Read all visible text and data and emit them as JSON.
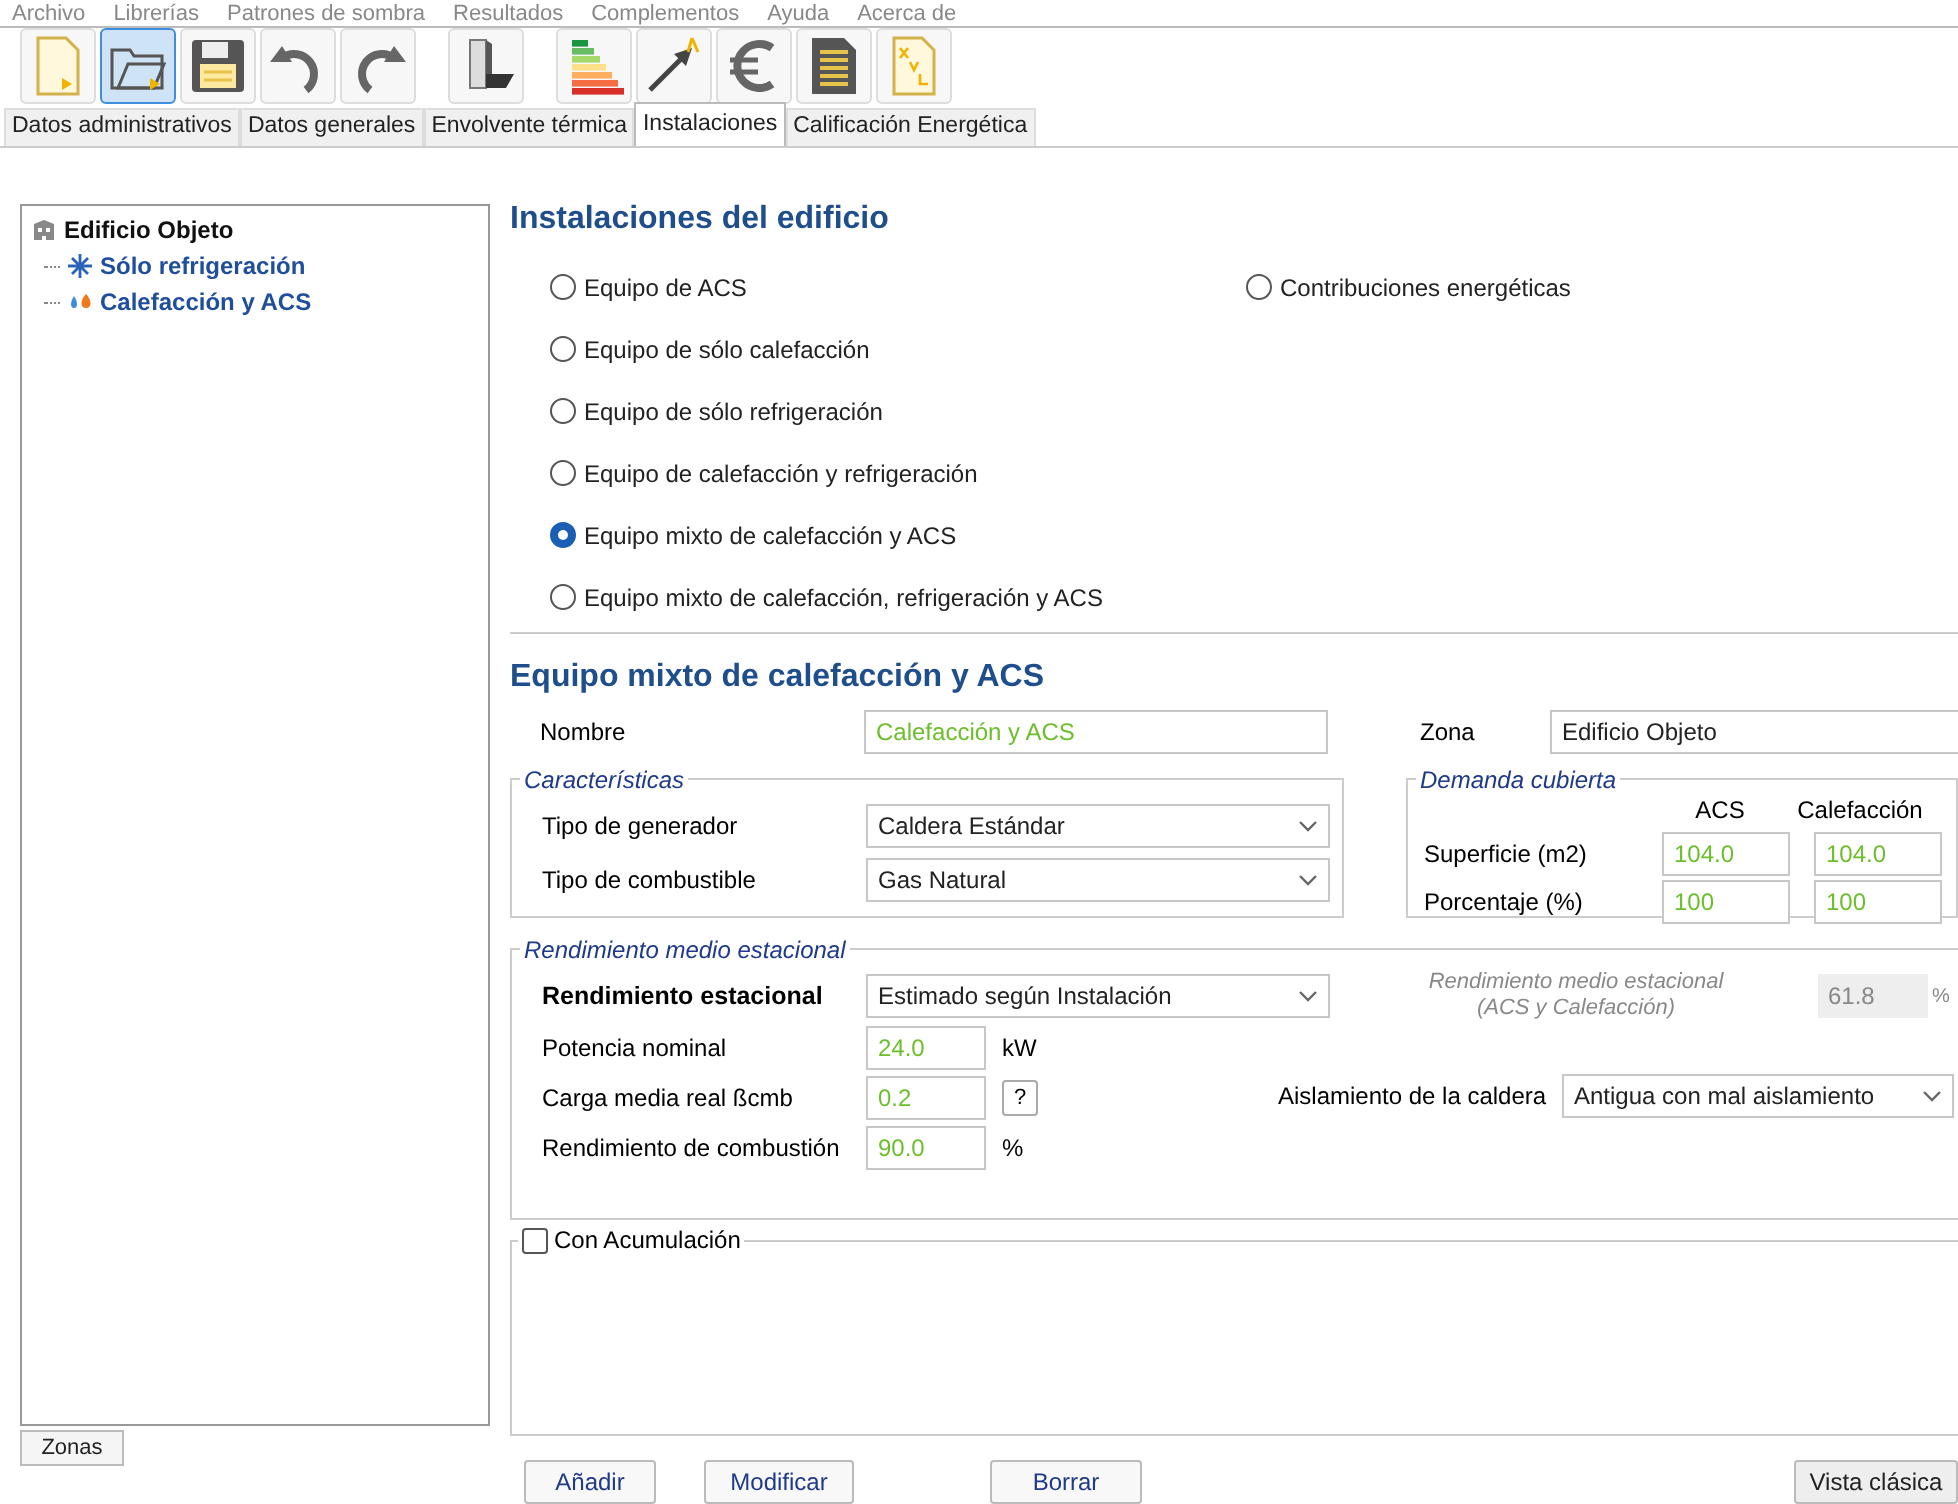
{
  "menu": [
    "Archivo",
    "Librerías",
    "Patrones de sombra",
    "Resultados",
    "Complementos",
    "Ayuda",
    "Acerca de"
  ],
  "toolbar": [
    {
      "kind": "new",
      "selected": false
    },
    {
      "kind": "open",
      "selected": true
    },
    {
      "kind": "save",
      "selected": false
    },
    {
      "kind": "undo",
      "selected": false
    },
    {
      "kind": "redo",
      "selected": false
    },
    {
      "kind": "building",
      "selected": false
    },
    {
      "kind": "rating",
      "selected": false
    },
    {
      "kind": "arrow",
      "selected": false
    },
    {
      "kind": "euro",
      "selected": false
    },
    {
      "kind": "report",
      "selected": false
    },
    {
      "kind": "xml",
      "selected": false
    }
  ],
  "tabs": [
    {
      "label": "Datos administrativos",
      "selected": false
    },
    {
      "label": "Datos generales",
      "selected": false
    },
    {
      "label": "Envolvente térmica",
      "selected": false
    },
    {
      "label": "Instalaciones",
      "selected": true
    },
    {
      "label": "Calificación Energética",
      "selected": false
    }
  ],
  "tree": {
    "label": "Edificio Objeto",
    "children": [
      {
        "label": "Sólo refrigeración",
        "kind": "cooling"
      },
      {
        "label": "Calefacción y ACS",
        "kind": "heating"
      }
    ]
  },
  "zones_button": "Zonas",
  "section_title": "Instalaciones del edificio",
  "options_left": [
    {
      "label": "Equipo de ACS",
      "selected": false
    },
    {
      "label": "Equipo de sólo calefacción",
      "selected": false
    },
    {
      "label": "Equipo de sólo refrigeración",
      "selected": false
    },
    {
      "label": "Equipo de calefacción y refrigeración",
      "selected": false
    },
    {
      "label": "Equipo mixto de calefacción y ACS",
      "selected": true
    },
    {
      "label": "Equipo mixto de calefacción, refrigeración y ACS",
      "selected": false
    }
  ],
  "options_right": [
    {
      "label": "Contribuciones energéticas",
      "selected": false
    }
  ],
  "form_title": "Equipo mixto de calefacción y ACS",
  "name": {
    "label": "Nombre",
    "value": "Calefacción y ACS"
  },
  "zone": {
    "label": "Zona",
    "value": "Edificio Objeto"
  },
  "characteristics": {
    "title": "Características",
    "rows": [
      {
        "label": "Tipo de generador",
        "value": "Caldera Estándar"
      },
      {
        "label": "Tipo de combustible",
        "value": "Gas Natural"
      }
    ]
  },
  "demand": {
    "title": "Demanda cubierta",
    "columns": [
      "ACS",
      "Calefacción"
    ],
    "rows": [
      {
        "label": "Superficie (m2)",
        "values": [
          "104.0",
          "104.0"
        ]
      },
      {
        "label": "Porcentaje (%)",
        "values": [
          "100",
          "100"
        ]
      }
    ]
  },
  "performance": {
    "title": "Rendimiento medio estacional",
    "main_label": "Rendimiento estacional",
    "main_value": "Estimado según Instalación",
    "readout_label": "Rendimiento medio estacional",
    "readout_sublabel": "(ACS y Calefacción)",
    "readout_value": "61.8",
    "readout_unit": "%",
    "fields": [
      {
        "label": "Potencia nominal",
        "value": "24.0",
        "unit": "kW",
        "kind": "unit"
      },
      {
        "label": "Carga media real ßcmb",
        "value": "0.2",
        "unit": "?",
        "kind": "help"
      },
      {
        "label": "Rendimiento de combustión",
        "value": "90.0",
        "unit": "%",
        "kind": "unit"
      }
    ],
    "insulation": {
      "label": "Aislamiento de la caldera",
      "value": "Antigua con mal aislamiento"
    }
  },
  "accumulation": {
    "label": "Con Acumulación",
    "checked": false
  },
  "buttons": [
    "Añadir",
    "Modificar",
    "Borrar"
  ],
  "classic_button": "Vista clásica"
}
